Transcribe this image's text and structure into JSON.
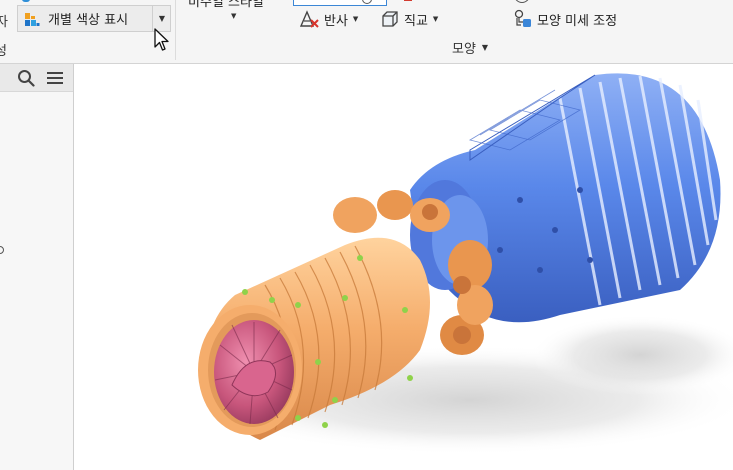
{
  "ribbon": {
    "left_fragment_top": "자",
    "left_fragment_bottom": "성",
    "display_button": {
      "label": "개별 색상 표시",
      "icon": "per-color-icon",
      "dropdown_icon": "dropdown-arrow-icon"
    },
    "visual_style": {
      "label": "비주얼 스타일"
    },
    "tools": [
      {
        "label": "반사",
        "icon": "reflection-icon"
      },
      {
        "label": "직교",
        "icon": "orthographic-icon"
      },
      {
        "label": "모양 미세 조정",
        "icon": "appearance-adjust-icon"
      }
    ],
    "group_label": "모양"
  },
  "browser_panel": {
    "search_icon": "search-icon",
    "menu_icon": "hamburger-menu-icon"
  },
  "viewport": {
    "model": "jet-engine-3d-model",
    "colors": {
      "intake": "#f5ad6c",
      "fan_blades": "#c8567c",
      "exhaust": "#4d80e6",
      "markers": "#8fd24a"
    }
  }
}
